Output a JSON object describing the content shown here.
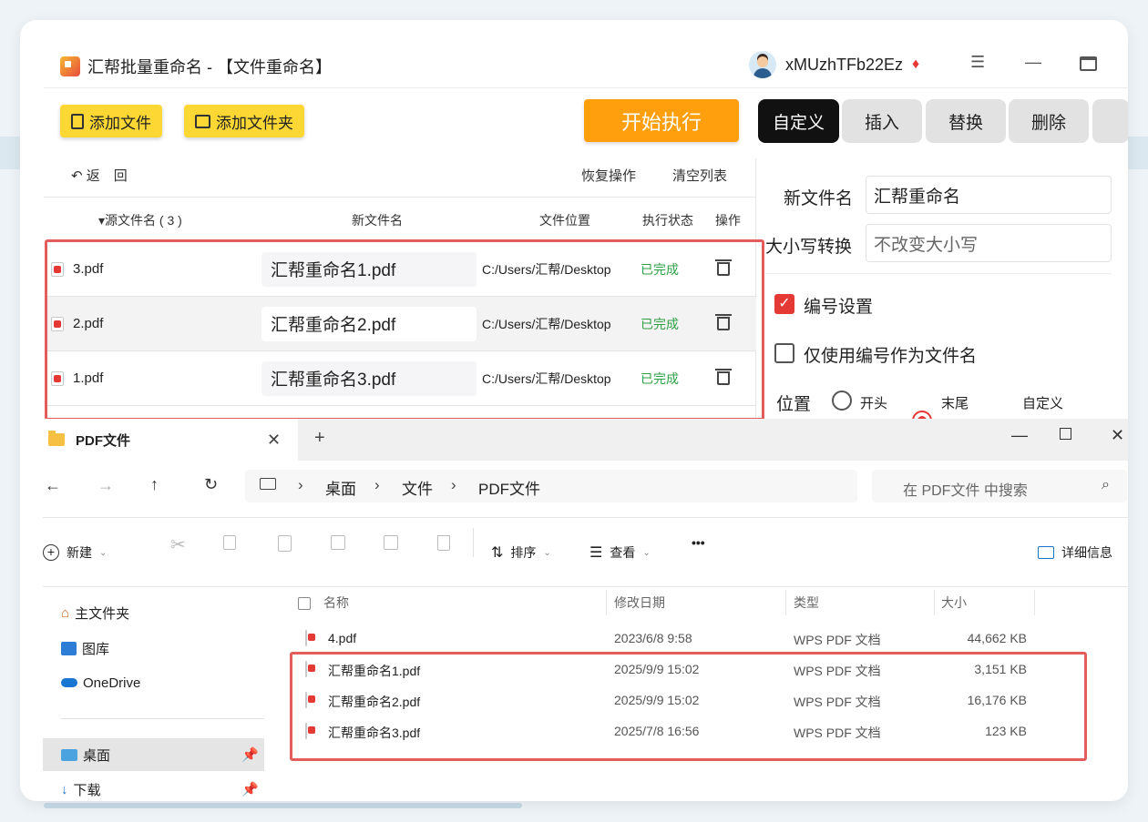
{
  "app": {
    "title": "汇帮批量重命名 - 【文件重命名】",
    "username": "xMUzhTFb22Ez"
  },
  "toolbar": {
    "add_file": "添加文件",
    "add_folder": "添加文件夹",
    "run": "开始执行"
  },
  "tabs": [
    "自定义",
    "插入",
    "替换",
    "删除"
  ],
  "list_toolbar": {
    "back": "返　回",
    "restore": "恢复操作",
    "clear": "清空列表"
  },
  "table": {
    "headers": {
      "source": "▾源文件名 ( 3 )",
      "new_name": "新文件名",
      "location": "文件位置",
      "status": "执行状态",
      "action": "操作"
    },
    "rows": [
      {
        "source": "3.pdf",
        "new_name": "汇帮重命名1.pdf",
        "location": "C:/Users/汇帮/Desktop",
        "status": "已完成"
      },
      {
        "source": "2.pdf",
        "new_name": "汇帮重命名2.pdf",
        "location": "C:/Users/汇帮/Desktop",
        "status": "已完成"
      },
      {
        "source": "1.pdf",
        "new_name": "汇帮重命名3.pdf",
        "location": "C:/Users/汇帮/Desktop",
        "status": "已完成"
      }
    ]
  },
  "settings": {
    "new_name_label": "新文件名",
    "new_name_value": "汇帮重命名",
    "case_label": "大小写转换",
    "case_value": "不改变大小写",
    "numbering_label": "编号设置",
    "numbering_checked": true,
    "only_number_label": "仅使用编号作为文件名",
    "only_number_checked": false,
    "position_label": "位置",
    "position_options": [
      "开头",
      "末尾",
      "自定义"
    ],
    "position_selected": "末尾"
  },
  "explorer": {
    "tab_title": "PDF文件",
    "breadcrumb": [
      "桌面",
      "文件",
      "PDF文件"
    ],
    "search_placeholder": "在 PDF文件 中搜索",
    "commands": {
      "new": "新建",
      "sort": "排序",
      "view": "查看",
      "more": "•••",
      "details": "详细信息"
    },
    "sidebar": [
      "主文件夹",
      "图库",
      "OneDrive",
      "桌面",
      "下载"
    ],
    "columns": {
      "name": "名称",
      "modified": "修改日期",
      "type": "类型",
      "size": "大小"
    },
    "files": [
      {
        "name": "4.pdf",
        "modified": "2023/6/8 9:58",
        "type": "WPS PDF 文档",
        "size": "44,662 KB"
      },
      {
        "name": "汇帮重命名1.pdf",
        "modified": "2025/9/9 15:02",
        "type": "WPS PDF 文档",
        "size": "3,151 KB"
      },
      {
        "name": "汇帮重命名2.pdf",
        "modified": "2025/9/9 15:02",
        "type": "WPS PDF 文档",
        "size": "16,176 KB"
      },
      {
        "name": "汇帮重命名3.pdf",
        "modified": "2025/7/8 16:56",
        "type": "WPS PDF 文档",
        "size": "123 KB"
      }
    ]
  },
  "colors": {
    "accent_orange": "#ff9f0e",
    "button_yellow": "#fdd835",
    "done_green": "#2ea043",
    "highlight_red": "#e35d5d",
    "active_tab": "#111111"
  }
}
